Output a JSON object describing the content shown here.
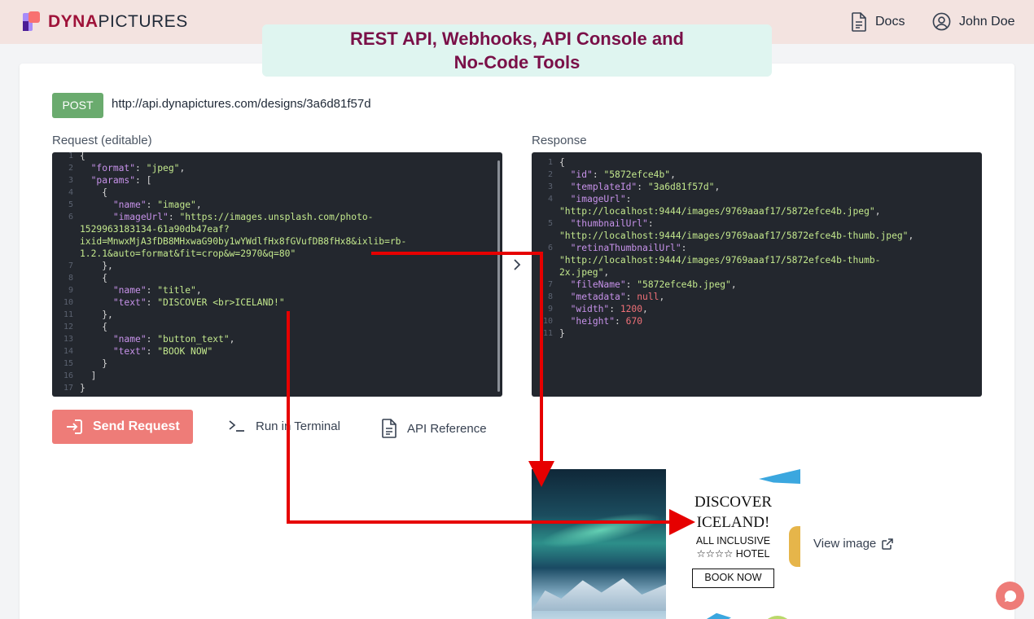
{
  "header": {
    "logo_prefix": "DYNA",
    "logo_suffix": "PICTURES",
    "docs_label": "Docs",
    "user_name": "John Doe"
  },
  "banner": {
    "line1": "REST API, Webhooks, API Console and",
    "line2": "No-Code Tools"
  },
  "request_bar": {
    "method": "POST",
    "url": "http://api.dynapictures.com/designs/3a6d81f57d"
  },
  "request": {
    "label": "Request (editable)",
    "lines": [
      [
        {
          "t": "p",
          "v": "{"
        }
      ],
      [
        {
          "t": "p",
          "v": "  "
        },
        {
          "t": "k",
          "v": "\"format\""
        },
        {
          "t": "p",
          "v": ": "
        },
        {
          "t": "s",
          "v": "\"jpeg\""
        },
        {
          "t": "p",
          "v": ","
        }
      ],
      [
        {
          "t": "p",
          "v": "  "
        },
        {
          "t": "k",
          "v": "\"params\""
        },
        {
          "t": "p",
          "v": ": ["
        }
      ],
      [
        {
          "t": "p",
          "v": "    {"
        }
      ],
      [
        {
          "t": "p",
          "v": "      "
        },
        {
          "t": "k",
          "v": "\"name\""
        },
        {
          "t": "p",
          "v": ": "
        },
        {
          "t": "s",
          "v": "\"image\""
        },
        {
          "t": "p",
          "v": ","
        }
      ],
      [
        {
          "t": "p",
          "v": "      "
        },
        {
          "t": "k",
          "v": "\"imageUrl\""
        },
        {
          "t": "p",
          "v": ": "
        },
        {
          "t": "s",
          "v": "\"https://images.unsplash.com/photo-"
        }
      ],
      [
        {
          "t": "s",
          "v": "1529963183134-61a90db47eaf?"
        }
      ],
      [
        {
          "t": "s",
          "v": "ixid=MnwxMjA3fDB8MHxwaG90by1wYWdlfHx8fGVufDB8fHx8&ixlib=rb-"
        }
      ],
      [
        {
          "t": "s",
          "v": "1.2.1&auto=format&fit=crop&w=2970&q=80\""
        }
      ],
      [
        {
          "t": "p",
          "v": "    },"
        }
      ],
      [
        {
          "t": "p",
          "v": "    {"
        }
      ],
      [
        {
          "t": "p",
          "v": "      "
        },
        {
          "t": "k",
          "v": "\"name\""
        },
        {
          "t": "p",
          "v": ": "
        },
        {
          "t": "s",
          "v": "\"title\""
        },
        {
          "t": "p",
          "v": ","
        }
      ],
      [
        {
          "t": "p",
          "v": "      "
        },
        {
          "t": "k",
          "v": "\"text\""
        },
        {
          "t": "p",
          "v": ": "
        },
        {
          "t": "s",
          "v": "\"DISCOVER <br>ICELAND!\""
        }
      ],
      [
        {
          "t": "p",
          "v": "    },"
        }
      ],
      [
        {
          "t": "p",
          "v": "    {"
        }
      ],
      [
        {
          "t": "p",
          "v": "      "
        },
        {
          "t": "k",
          "v": "\"name\""
        },
        {
          "t": "p",
          "v": ": "
        },
        {
          "t": "s",
          "v": "\"button_text\""
        },
        {
          "t": "p",
          "v": ","
        }
      ],
      [
        {
          "t": "p",
          "v": "      "
        },
        {
          "t": "k",
          "v": "\"text\""
        },
        {
          "t": "p",
          "v": ": "
        },
        {
          "t": "s",
          "v": "\"BOOK NOW\""
        }
      ],
      [
        {
          "t": "p",
          "v": "    }"
        }
      ],
      [
        {
          "t": "p",
          "v": "  ]"
        }
      ],
      [
        {
          "t": "p",
          "v": "}"
        }
      ]
    ],
    "gutter": [
      "1",
      "2",
      "3",
      "4",
      "5",
      "6",
      "",
      "",
      "",
      "7",
      "8",
      "9",
      "10",
      "11",
      "12",
      "13",
      "14",
      "15",
      "16",
      "17"
    ]
  },
  "response": {
    "label": "Response",
    "lines": [
      [
        {
          "t": "p",
          "v": "{"
        }
      ],
      [
        {
          "t": "p",
          "v": "  "
        },
        {
          "t": "k",
          "v": "\"id\""
        },
        {
          "t": "p",
          "v": ": "
        },
        {
          "t": "s",
          "v": "\"5872efce4b\""
        },
        {
          "t": "p",
          "v": ","
        }
      ],
      [
        {
          "t": "p",
          "v": "  "
        },
        {
          "t": "k",
          "v": "\"templateId\""
        },
        {
          "t": "p",
          "v": ": "
        },
        {
          "t": "s",
          "v": "\"3a6d81f57d\""
        },
        {
          "t": "p",
          "v": ","
        }
      ],
      [
        {
          "t": "p",
          "v": "  "
        },
        {
          "t": "k",
          "v": "\"imageUrl\""
        },
        {
          "t": "p",
          "v": ":"
        }
      ],
      [
        {
          "t": "s",
          "v": "\"http://localhost:9444/images/9769aaaf17/5872efce4b.jpeg\""
        },
        {
          "t": "p",
          "v": ","
        }
      ],
      [
        {
          "t": "p",
          "v": "  "
        },
        {
          "t": "k",
          "v": "\"thumbnailUrl\""
        },
        {
          "t": "p",
          "v": ":"
        }
      ],
      [
        {
          "t": "s",
          "v": "\"http://localhost:9444/images/9769aaaf17/5872efce4b-thumb.jpeg\""
        },
        {
          "t": "p",
          "v": ","
        }
      ],
      [
        {
          "t": "p",
          "v": "  "
        },
        {
          "t": "k",
          "v": "\"retinaThumbnailUrl\""
        },
        {
          "t": "p",
          "v": ":"
        }
      ],
      [
        {
          "t": "s",
          "v": "\"http://localhost:9444/images/9769aaaf17/5872efce4b-thumb-"
        }
      ],
      [
        {
          "t": "s",
          "v": "2x.jpeg\""
        },
        {
          "t": "p",
          "v": ","
        }
      ],
      [
        {
          "t": "p",
          "v": "  "
        },
        {
          "t": "k",
          "v": "\"fileName\""
        },
        {
          "t": "p",
          "v": ": "
        },
        {
          "t": "s",
          "v": "\"5872efce4b.jpeg\""
        },
        {
          "t": "p",
          "v": ","
        }
      ],
      [
        {
          "t": "p",
          "v": "  "
        },
        {
          "t": "k",
          "v": "\"metadata\""
        },
        {
          "t": "p",
          "v": ": "
        },
        {
          "t": "n",
          "v": "null"
        },
        {
          "t": "p",
          "v": ","
        }
      ],
      [
        {
          "t": "p",
          "v": "  "
        },
        {
          "t": "k",
          "v": "\"width\""
        },
        {
          "t": "p",
          "v": ": "
        },
        {
          "t": "n",
          "v": "1200"
        },
        {
          "t": "p",
          "v": ","
        }
      ],
      [
        {
          "t": "p",
          "v": "  "
        },
        {
          "t": "k",
          "v": "\"height\""
        },
        {
          "t": "p",
          "v": ": "
        },
        {
          "t": "n",
          "v": "670"
        }
      ],
      [
        {
          "t": "p",
          "v": "}"
        }
      ]
    ],
    "gutter": [
      "1",
      "2",
      "3",
      "4",
      "",
      "5",
      "",
      "6",
      "",
      "",
      "7",
      "8",
      "9",
      "10",
      "11"
    ]
  },
  "actions": {
    "send": "Send Request",
    "terminal": "Run in Terminal",
    "reference": "API Reference"
  },
  "preview": {
    "title_line1": "DISCOVER",
    "title_line2": "ICELAND!",
    "sub_line1": "ALL INCLUSIVE",
    "sub_line2": "☆☆☆☆ HOTEL",
    "button": "BOOK NOW",
    "view_label": "View image"
  },
  "colors": {
    "accent": "#ee7c78",
    "post": "#6aab6e",
    "arrow": "#e60000",
    "banner_text": "#7a1048"
  }
}
